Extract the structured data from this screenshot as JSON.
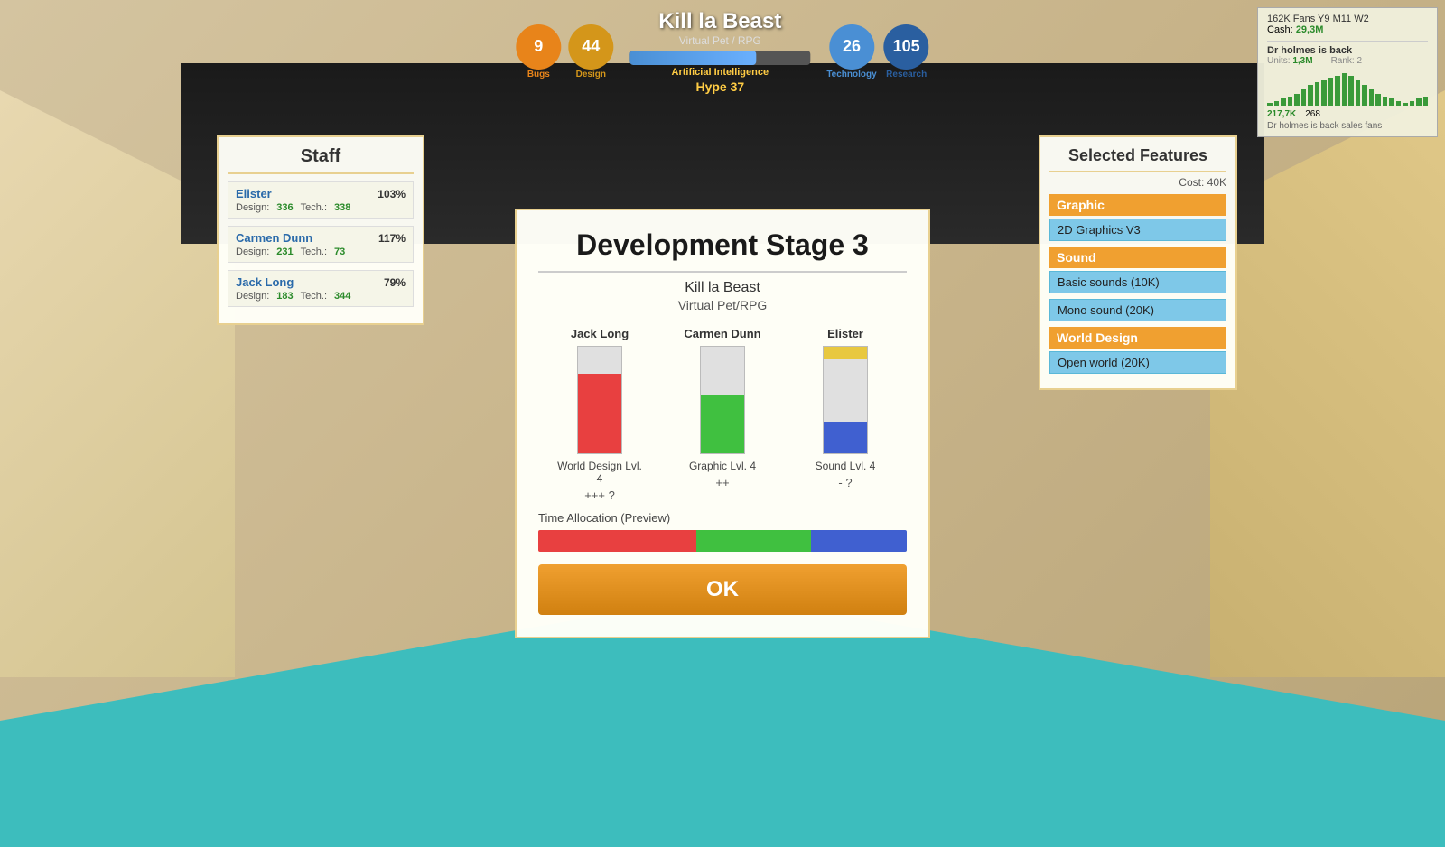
{
  "game": {
    "title": "Kill la Beast",
    "genre": "Virtual Pet / RPG",
    "subtitle": "Virtual Pet/RPG"
  },
  "hud": {
    "bugs": "9",
    "bugs_label": "Bugs",
    "design": "44",
    "design_label": "Design",
    "hype": "Hype 37",
    "progress_label": "Artificial Intelligence",
    "progress_pct": 70,
    "technology": "26",
    "technology_label": "Technology",
    "research": "105",
    "research_label": "Research"
  },
  "top_right": {
    "fans_line": "162K Fans Y9 M11 W2",
    "cash_label": "Cash:",
    "cash_value": "29,3M",
    "news_title": "Dr holmes is back",
    "units_label": "Units:",
    "units_value": "1,3M",
    "rank_label": "Rank:",
    "rank_value": "2",
    "sales_desc": "Dr holmes is back sales fans",
    "stat1_label": "217,7K",
    "stat2_label": "268"
  },
  "staff_panel": {
    "title": "Staff",
    "members": [
      {
        "name": "Elister",
        "percent": "103%",
        "design_label": "Design:",
        "design_val": "336",
        "tech_label": "Tech.:",
        "tech_val": "338"
      },
      {
        "name": "Carmen Dunn",
        "percent": "117%",
        "design_label": "Design:",
        "design_val": "231",
        "tech_label": "Tech.:",
        "tech_val": "73"
      },
      {
        "name": "Jack Long",
        "percent": "79%",
        "design_label": "Design:",
        "design_val": "183",
        "tech_label": "Tech.:",
        "tech_val": "344"
      }
    ]
  },
  "modal": {
    "title": "Development Stage 3",
    "game_name": "Kill la Beast",
    "game_genre": "Virtual Pet/RPG",
    "staff_bars": [
      {
        "name": "Jack Long",
        "bar_color": "red",
        "fill_pct": 75,
        "level": "World Design Lvl. 4",
        "rating": "+++ ?"
      },
      {
        "name": "Carmen Dunn",
        "bar_color": "green",
        "fill_pct": 55,
        "level": "Graphic Lvl. 4",
        "rating": "++"
      },
      {
        "name": "Elister",
        "bar_color": "blue",
        "fill_pct": 30,
        "level": "Sound Lvl. 4",
        "rating": "- ?"
      }
    ],
    "time_label": "Time Allocation (Preview)",
    "time_segs": [
      {
        "color": "red",
        "pct": 43
      },
      {
        "color": "green",
        "pct": 31
      },
      {
        "color": "blue",
        "pct": 26
      }
    ],
    "ok_label": "OK"
  },
  "features_panel": {
    "title": "Selected Features",
    "cost_label": "Cost: 40K",
    "categories": [
      {
        "name": "Graphic",
        "items": [
          "2D Graphics V3"
        ]
      },
      {
        "name": "Sound",
        "items": [
          "Basic sounds (10K)",
          "Mono sound (20K)"
        ]
      },
      {
        "name": "World Design",
        "items": [
          "Open world (20K)"
        ]
      }
    ]
  },
  "chart_bars": [
    2,
    4,
    6,
    8,
    10,
    14,
    18,
    20,
    22,
    24,
    26,
    28,
    26,
    22,
    18,
    14,
    10,
    8,
    6,
    4,
    2,
    4,
    6,
    8
  ]
}
